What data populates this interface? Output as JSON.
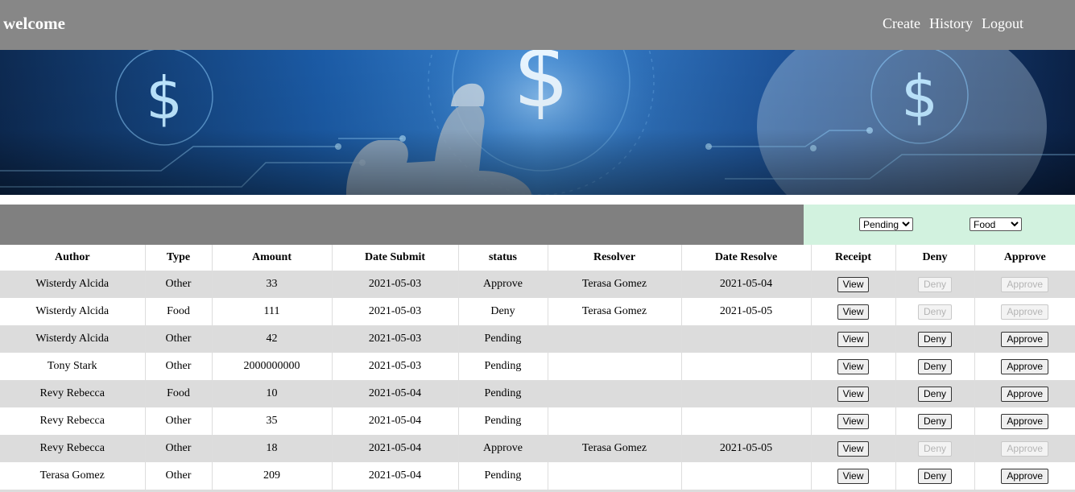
{
  "header": {
    "title": "welcome",
    "nav": [
      "Create",
      "History",
      "Logout"
    ]
  },
  "banner": {
    "icon": "dollar-sign-icon",
    "accent": "#1e5fa8"
  },
  "filters": {
    "status": {
      "selected": "Pending",
      "options": [
        "Pending"
      ]
    },
    "type": {
      "selected": "Food",
      "options": [
        "Food"
      ]
    }
  },
  "table": {
    "columns": [
      "Author",
      "Type",
      "Amount",
      "Date Submit",
      "status",
      "Resolver",
      "Date Resolve",
      "Receipt",
      "Deny",
      "Approve"
    ],
    "rows": [
      {
        "author": "Wisterdy Alcida",
        "type": "Other",
        "amount": "33",
        "date_submit": "2021-05-03",
        "status": "Approve",
        "resolver": "Terasa Gomez",
        "date_resolve": "2021-05-04",
        "receipt": "View",
        "deny": "Deny",
        "approve": "Approve"
      },
      {
        "author": "Wisterdy Alcida",
        "type": "Food",
        "amount": "111",
        "date_submit": "2021-05-03",
        "status": "Deny",
        "resolver": "Terasa Gomez",
        "date_resolve": "2021-05-05",
        "receipt": "View",
        "deny": "Deny",
        "approve": "Approve"
      },
      {
        "author": "Wisterdy Alcida",
        "type": "Other",
        "amount": "42",
        "date_submit": "2021-05-03",
        "status": "Pending",
        "resolver": "",
        "date_resolve": "",
        "receipt": "View",
        "deny": "Deny",
        "approve": "Approve"
      },
      {
        "author": "Tony Stark",
        "type": "Other",
        "amount": "2000000000",
        "date_submit": "2021-05-03",
        "status": "Pending",
        "resolver": "",
        "date_resolve": "",
        "receipt": "View",
        "deny": "Deny",
        "approve": "Approve"
      },
      {
        "author": "Revy Rebecca",
        "type": "Food",
        "amount": "10",
        "date_submit": "2021-05-04",
        "status": "Pending",
        "resolver": "",
        "date_resolve": "",
        "receipt": "View",
        "deny": "Deny",
        "approve": "Approve"
      },
      {
        "author": "Revy Rebecca",
        "type": "Other",
        "amount": "35",
        "date_submit": "2021-05-04",
        "status": "Pending",
        "resolver": "",
        "date_resolve": "",
        "receipt": "View",
        "deny": "Deny",
        "approve": "Approve"
      },
      {
        "author": "Revy Rebecca",
        "type": "Other",
        "amount": "18",
        "date_submit": "2021-05-04",
        "status": "Approve",
        "resolver": "Terasa Gomez",
        "date_resolve": "2021-05-05",
        "receipt": "View",
        "deny": "Deny",
        "approve": "Approve"
      },
      {
        "author": "Terasa Gomez",
        "type": "Other",
        "amount": "209",
        "date_submit": "2021-05-04",
        "status": "Pending",
        "resolver": "",
        "date_resolve": "",
        "receipt": "View",
        "deny": "Deny",
        "approve": "Approve"
      }
    ]
  }
}
